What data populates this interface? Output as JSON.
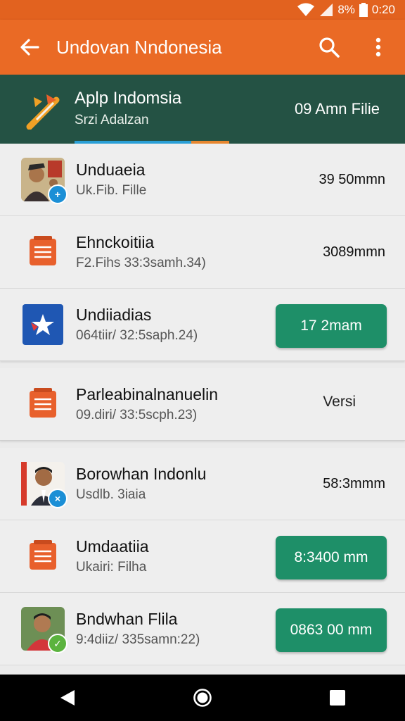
{
  "status_bar": {
    "battery_text": "8%",
    "time": "0:20",
    "icons": [
      "wifi-icon",
      "signal-icon",
      "battery-icon"
    ]
  },
  "app_bar": {
    "title": "Undovan Nndonesia",
    "icons": [
      "back-arrow-icon",
      "search-icon",
      "more-vert-icon"
    ]
  },
  "header": {
    "title": "Aplp Indomsia",
    "subtitle": "Srzi Adalzan",
    "right_text": "09 Amn Filie"
  },
  "items": [
    {
      "name": "Unduaeia",
      "meta": "Uk.Fib. Fille",
      "size": "39 50mmn",
      "thumb": "photo",
      "button": false
    },
    {
      "name": "Ehnckoitiia",
      "meta": "F2.Fihs 33:3samh.34)",
      "size": "3089mmn",
      "thumb": "document",
      "button": false
    },
    {
      "name": "Undiiadias",
      "meta": "064tiir/ 32:5saph.24)",
      "size": "17 2mam",
      "thumb": "app",
      "button": true
    },
    {
      "name": "Parleabinalnanuelin",
      "meta": "09.diri/ 33:5scph.23)",
      "size": "Versi",
      "thumb": "document",
      "button": false
    },
    {
      "name": "Borowhan Indonlu",
      "meta": "Usdlb. 3iaia",
      "size": "58:3mmm",
      "thumb": "photo",
      "button": false
    },
    {
      "name": "Umdaatiia",
      "meta": "Ukairi: Filha",
      "size": "8:3400 mm",
      "thumb": "document",
      "button": true
    },
    {
      "name": "Bndwhan Flila",
      "meta": "9:4diiz/ 335samn:22)",
      "size": "0863 00 mm",
      "thumb": "photo",
      "button": true
    }
  ],
  "nav_bar": {
    "icons": [
      "nav-back-icon",
      "nav-home-icon",
      "nav-recents-icon"
    ]
  },
  "colors": {
    "app_bar": "#ea6a25",
    "header": "#245244",
    "accent_button": "#1e8f68",
    "document_icon": "#e8602c"
  }
}
